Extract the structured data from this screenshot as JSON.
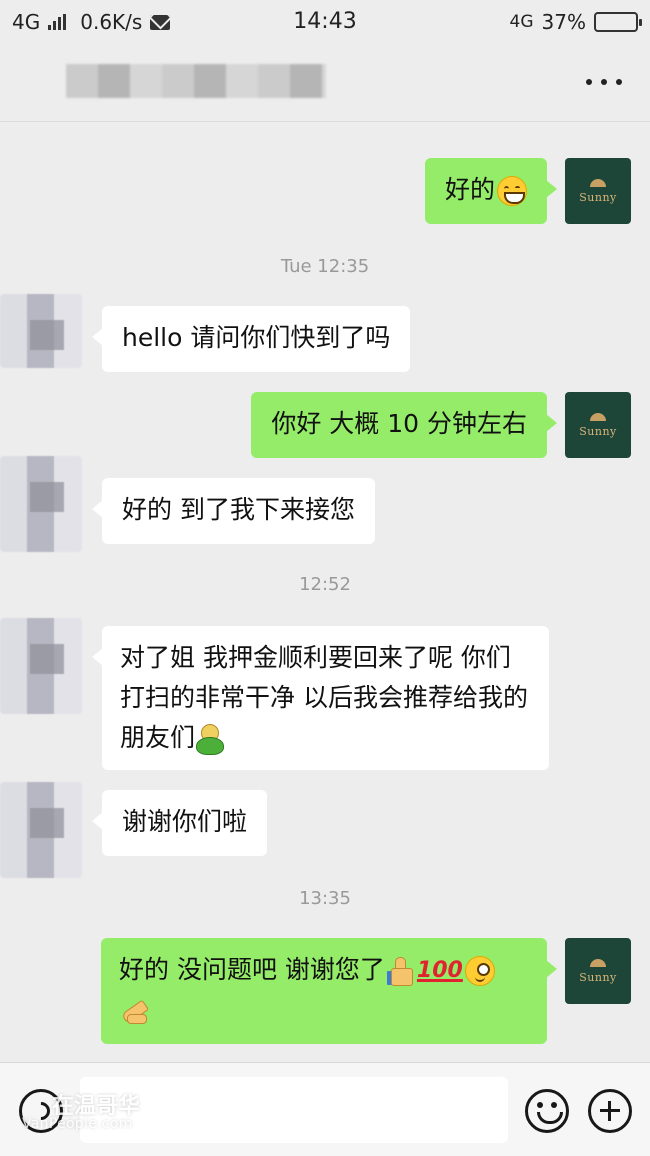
{
  "status_bar": {
    "network_left": "4G",
    "speed": "0.6K/s",
    "time": "14:43",
    "network_right": "4G",
    "battery": "37%",
    "battery_level": 0.37
  },
  "my_avatar_label": "Sunny",
  "messages": [
    {
      "type": "msg",
      "side": "me",
      "text": "好的",
      "emojis": [
        "grin"
      ]
    },
    {
      "type": "time",
      "text": "Tue 12:35"
    },
    {
      "type": "msg",
      "side": "peer",
      "text": "hello 请问你们快到了吗"
    },
    {
      "type": "msg",
      "side": "me",
      "text": "你好 大概 10 分钟左右"
    },
    {
      "type": "msg",
      "side": "peer",
      "text": "好的 到了我下来接您"
    },
    {
      "type": "time",
      "text": "12:52"
    },
    {
      "type": "msg",
      "side": "peer",
      "text": "对了姐 我押金顺利要回来了呢 你们打扫的非常干净 以后我会推荐给我的朋友们",
      "emojis": [
        "turtle"
      ]
    },
    {
      "type": "msg",
      "side": "peer",
      "text": "谢谢你们啦"
    },
    {
      "type": "time",
      "text": "13:35"
    },
    {
      "type": "msg",
      "side": "me",
      "text": "好的 没问题吧 谢谢您了",
      "emojis": [
        "thumbs-up",
        "hundred",
        "wink",
        "ok-hand"
      ],
      "hundred_text": "100"
    }
  ],
  "input": {
    "placeholder": "",
    "value": ""
  },
  "watermark": {
    "main": "在温哥华",
    "sub": "VanPeople.com"
  }
}
